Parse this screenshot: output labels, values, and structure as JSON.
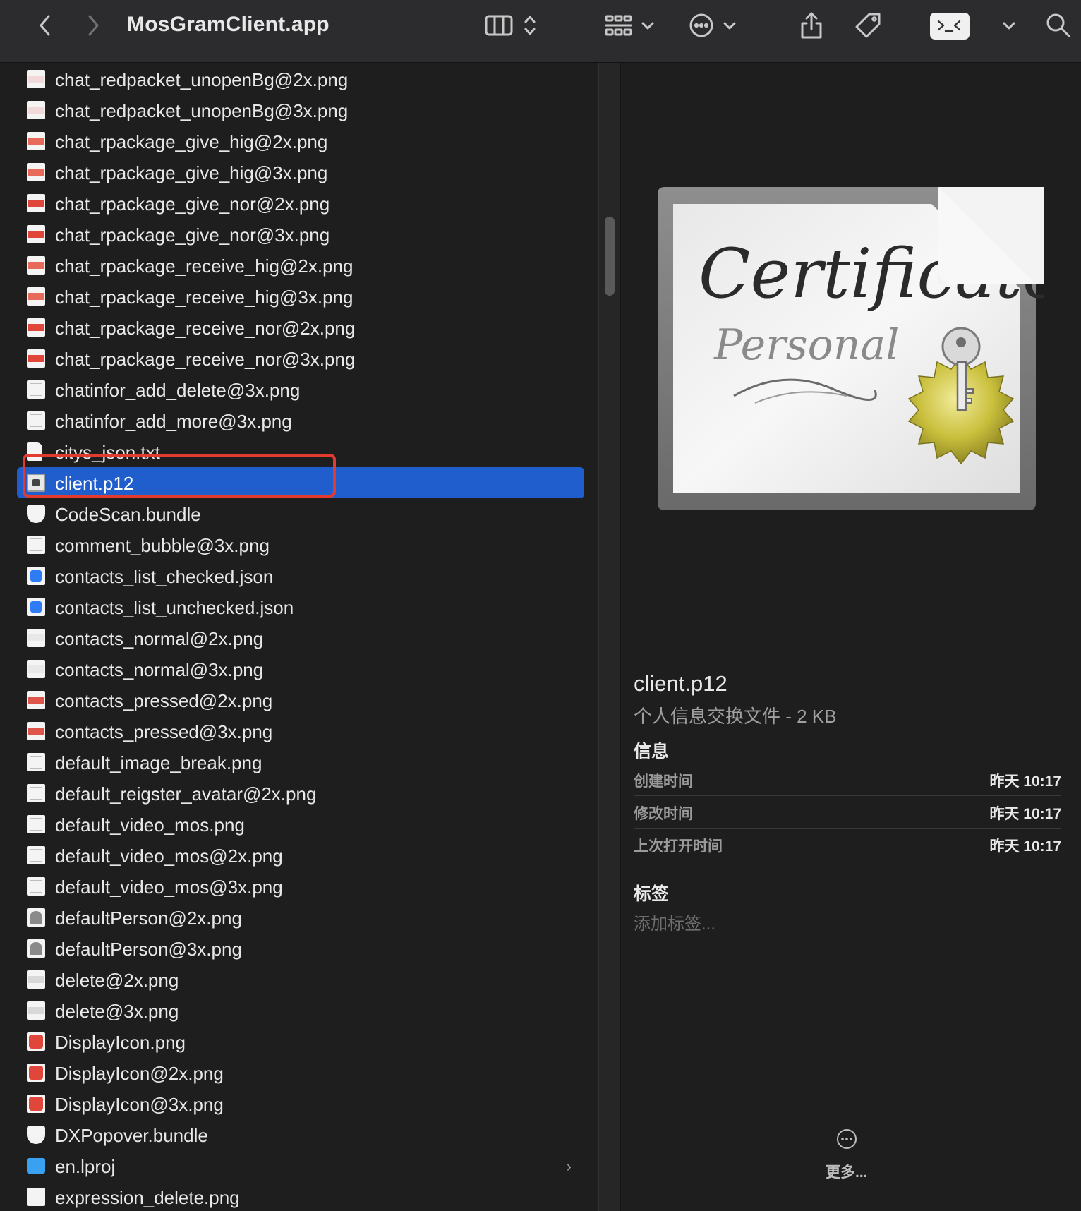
{
  "window": {
    "title": "MosGramClient.app"
  },
  "toolbar": {
    "icons": [
      "back-icon",
      "forward-icon",
      "columns-view-icon",
      "sort-stepper-icon",
      "group-grid-icon",
      "chevron-down-icon",
      "more-actions-icon",
      "share-icon",
      "tag-icon",
      "terminal-icon",
      "search-icon"
    ]
  },
  "files": [
    {
      "name": "chat_redpacket_unopenBg@2x.png",
      "icon": "image-icon",
      "color": "#f2d9d9"
    },
    {
      "name": "chat_redpacket_unopenBg@3x.png",
      "icon": "image-icon",
      "color": "#f2d9d9"
    },
    {
      "name": "chat_rpackage_give_hig@2x.png",
      "icon": "image-icon",
      "color": "#e86b5a"
    },
    {
      "name": "chat_rpackage_give_hig@3x.png",
      "icon": "image-icon",
      "color": "#e86b5a"
    },
    {
      "name": "chat_rpackage_give_nor@2x.png",
      "icon": "image-icon",
      "color": "#e0463a"
    },
    {
      "name": "chat_rpackage_give_nor@3x.png",
      "icon": "image-icon",
      "color": "#e0463a"
    },
    {
      "name": "chat_rpackage_receive_hig@2x.png",
      "icon": "image-icon",
      "color": "#e86b5a"
    },
    {
      "name": "chat_rpackage_receive_hig@3x.png",
      "icon": "image-icon",
      "color": "#e86b5a"
    },
    {
      "name": "chat_rpackage_receive_nor@2x.png",
      "icon": "image-icon",
      "color": "#e0463a"
    },
    {
      "name": "chat_rpackage_receive_nor@3x.png",
      "icon": "image-icon",
      "color": "#e0463a"
    },
    {
      "name": "chatinfor_add_delete@3x.png",
      "icon": "image-icon",
      "color": "#f4f4f4"
    },
    {
      "name": "chatinfor_add_more@3x.png",
      "icon": "image-icon",
      "color": "#f4f4f4"
    },
    {
      "name": "citys_json.txt",
      "icon": "text-document-icon",
      "color": "#f4f4f4"
    },
    {
      "name": "client.p12",
      "icon": "certificate-icon",
      "color": "#dcdcdc",
      "selected": true
    },
    {
      "name": "CodeScan.bundle",
      "icon": "bundle-icon",
      "color": "#f4f4f4"
    },
    {
      "name": "comment_bubble@3x.png",
      "icon": "image-icon",
      "color": "#f4f4f4"
    },
    {
      "name": "contacts_list_checked.json",
      "icon": "json-icon",
      "color": "#2f7df6"
    },
    {
      "name": "contacts_list_unchecked.json",
      "icon": "json-icon",
      "color": "#2f7df6"
    },
    {
      "name": "contacts_normal@2x.png",
      "icon": "image-icon",
      "color": "#e8e8e8"
    },
    {
      "name": "contacts_normal@3x.png",
      "icon": "image-icon",
      "color": "#e8e8e8"
    },
    {
      "name": "contacts_pressed@2x.png",
      "icon": "image-icon",
      "color": "#e0554a"
    },
    {
      "name": "contacts_pressed@3x.png",
      "icon": "image-icon",
      "color": "#e0554a"
    },
    {
      "name": "default_image_break.png",
      "icon": "image-icon",
      "color": "#f4f4f4"
    },
    {
      "name": "default_reigster_avatar@2x.png",
      "icon": "image-icon",
      "color": "#f4f4f4"
    },
    {
      "name": "default_video_mos.png",
      "icon": "image-icon",
      "color": "#f4f4f4"
    },
    {
      "name": "default_video_mos@2x.png",
      "icon": "image-icon",
      "color": "#f4f4f4"
    },
    {
      "name": "default_video_mos@3x.png",
      "icon": "image-icon",
      "color": "#f4f4f4"
    },
    {
      "name": "defaultPerson@2x.png",
      "icon": "person-image-icon",
      "color": "#d6d6d6"
    },
    {
      "name": "defaultPerson@3x.png",
      "icon": "person-image-icon",
      "color": "#d6d6d6"
    },
    {
      "name": "delete@2x.png",
      "icon": "image-icon",
      "color": "#d8d8d8"
    },
    {
      "name": "delete@3x.png",
      "icon": "image-icon",
      "color": "#d8d8d8"
    },
    {
      "name": "DisplayIcon.png",
      "icon": "app-image-icon",
      "color": "#e0463a"
    },
    {
      "name": "DisplayIcon@2x.png",
      "icon": "app-image-icon",
      "color": "#e0463a"
    },
    {
      "name": "DisplayIcon@3x.png",
      "icon": "app-image-icon",
      "color": "#e0463a"
    },
    {
      "name": "DXPopover.bundle",
      "icon": "bundle-icon",
      "color": "#f4f4f4"
    },
    {
      "name": "en.lproj",
      "icon": "folder-icon",
      "color": "#3aa0f0",
      "folder": true
    },
    {
      "name": "expression_delete.png",
      "icon": "image-icon",
      "color": "#f4f4f4"
    }
  ],
  "preview": {
    "certificate_script_word": "Certificate",
    "certificate_sub_word": "Personal",
    "file_name": "client.p12",
    "file_kind": "个人信息交换文件 - 2 KB",
    "info_heading": "信息",
    "info": [
      {
        "label": "创建时间",
        "value": "昨天 10:17"
      },
      {
        "label": "修改时间",
        "value": "昨天 10:17"
      },
      {
        "label": "上次打开时间",
        "value": "昨天 10:17"
      }
    ],
    "tags_heading": "标签",
    "tags_placeholder": "添加标签...",
    "more_label": "更多..."
  },
  "colors": {
    "selection": "#1f5ecc",
    "highlight_box": "#e53a2e",
    "background": "#1e1e1e"
  }
}
